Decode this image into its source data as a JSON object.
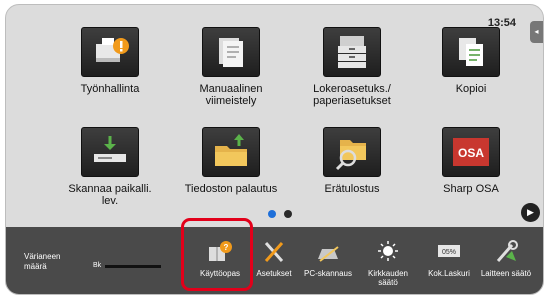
{
  "status": {
    "clock": "13:54",
    "side_tab_glyph": "◂"
  },
  "apps": [
    {
      "label": "Työnhallinta",
      "icon": "job-status-icon"
    },
    {
      "label": "Manuaalinen viimeistely",
      "icon": "manual-finishing-icon"
    },
    {
      "label": "Lokeroasetuks./ paperiasetukset",
      "icon": "tray-settings-icon"
    },
    {
      "label": "Kopioi",
      "icon": "copy-icon"
    },
    {
      "label": "Skannaa paikalli. lev.",
      "icon": "scan-to-local-drive-icon"
    },
    {
      "label": "Tiedoston palautus",
      "icon": "file-retrieve-icon"
    },
    {
      "label": "Erätulostus",
      "icon": "batch-print-icon"
    },
    {
      "label": "Sharp OSA",
      "icon": "sharp-osa-icon",
      "logo_text": "OSA"
    }
  ],
  "pagination": {
    "current": 1,
    "total": 2,
    "active_color": "#1e6fd9",
    "inactive_color": "#2a2a2a"
  },
  "next_button": {
    "glyph": "▶"
  },
  "taskbar": {
    "toner": {
      "label": "Värianeen määrä",
      "bk_label": "Bk"
    },
    "shortcuts": [
      {
        "label": "Käyttöopas",
        "icon": "manual-book-icon",
        "highlighted": true
      },
      {
        "label": "Asetukset",
        "icon": "settings-tools-icon"
      },
      {
        "label": "PC-skannaus",
        "icon": "pc-scan-icon"
      },
      {
        "label": "Kirkkauden säätö",
        "icon": "brightness-icon"
      },
      {
        "label": "Kok.Laskuri",
        "icon": "total-count-icon",
        "counter_text": "05%"
      },
      {
        "label": "Laitteen säätö",
        "icon": "device-adjust-icon"
      }
    ]
  },
  "colors": {
    "highlight": "#e2001a",
    "accent_orange": "#f19a1b"
  }
}
